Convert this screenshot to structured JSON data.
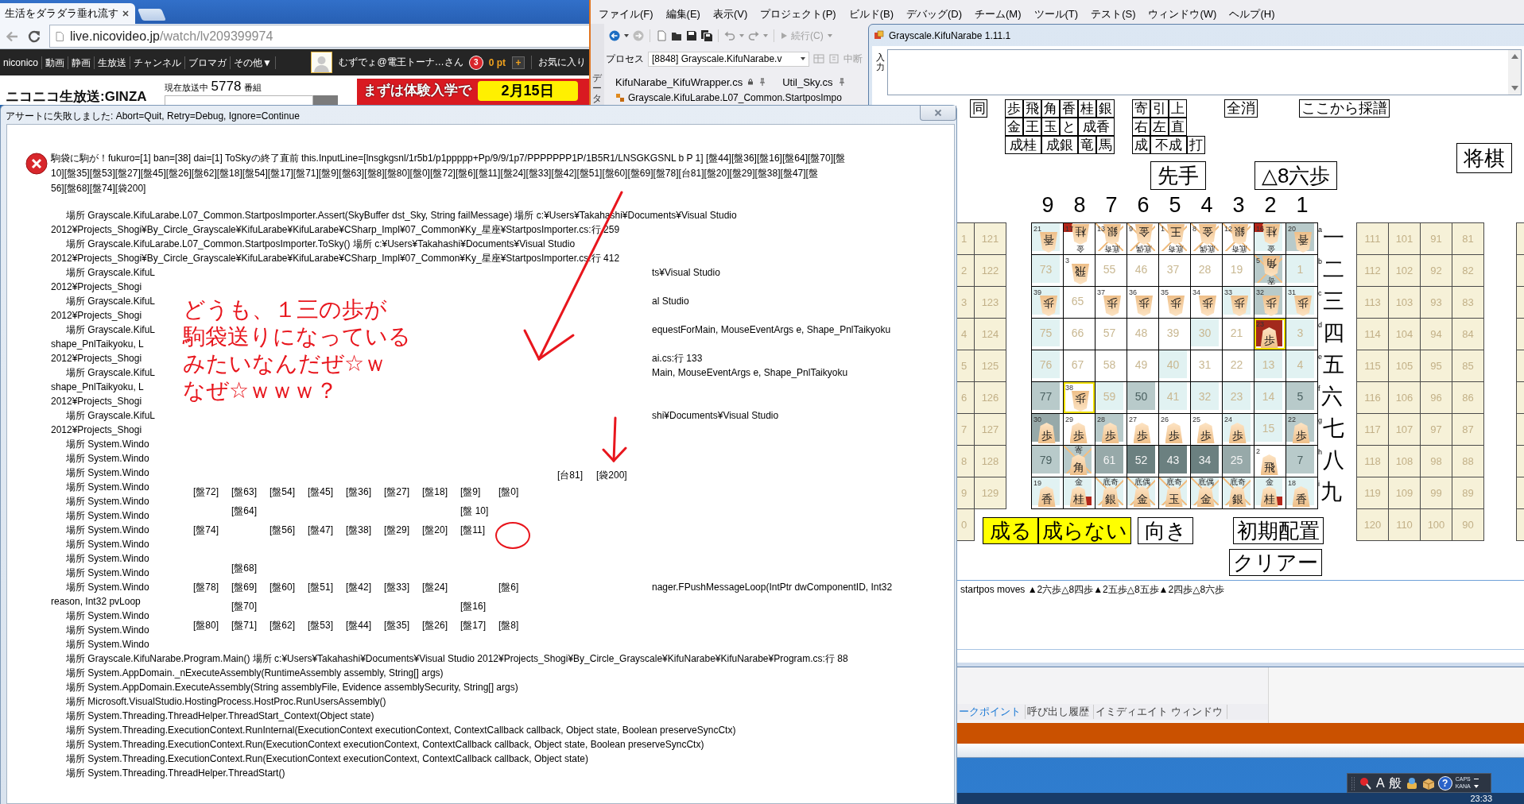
{
  "browser": {
    "tab_title": "生活をダラダラ垂れ流す",
    "url_host": "live.nicovideo.jp",
    "url_path": "/watch/lv209399974",
    "site_nav": [
      "niconico",
      "動画",
      "静画",
      "生放送",
      "チャンネル",
      "ブロマガ",
      "その他▼"
    ],
    "user_name": "むずでょ@電王トーナ…さん",
    "notice_count": "3",
    "points": "0 pt",
    "add_points": "+",
    "favorites": "お気に入り",
    "logo": "ニコニコ生放送:GINZA",
    "on_air_label": "現在放送中",
    "on_air_count": "5778",
    "on_air_unit": "番組",
    "banner_text": "まずは体験入学で",
    "banner_date": "2月15日"
  },
  "ide": {
    "menu": [
      "ファイル(F)",
      "編集(E)",
      "表示(V)",
      "プロジェクト(P)",
      "ビルド(B)",
      "デバッグ(D)",
      "チーム(M)",
      "ツール(T)",
      "テスト(S)",
      "ウィンドウ(W)",
      "ヘルプ(H)"
    ],
    "continue": "続行(C)",
    "process_label": "プロセス",
    "process": "[8848] Grayscale.KifuNarabe.v",
    "break_all": "中断",
    "doc_tabs": [
      "KifuNarabe_KifuWrapper.cs",
      "Util_Sky.cs"
    ],
    "navigation": "Grayscale.KifuLarabe.L07_Common.StartposImpo",
    "side_tab": "データ",
    "tool_tabs": [
      {
        "label": "ークポイント",
        "selected": true
      },
      {
        "label": "呼び出し履歴",
        "selected": false
      },
      {
        "label": "イミディエイト ウィンドウ",
        "selected": false
      }
    ]
  },
  "kifu_window": {
    "title": "Grayscale.KifuNarabe 1.11.1",
    "input_label": "入力",
    "same_button": "同",
    "piece_buttons": [
      [
        "歩",
        "飛",
        "角",
        "香",
        "桂",
        "銀"
      ],
      [
        "金",
        "王",
        "玉",
        "と",
        "成香"
      ],
      [
        "成桂",
        "成銀",
        "竜",
        "馬"
      ]
    ],
    "move_buttons": [
      [
        "寄",
        "引",
        "上"
      ],
      [
        "右",
        "左",
        "直"
      ],
      [
        "成",
        "不成",
        "打"
      ]
    ],
    "clear_all": "全消",
    "record_from_here": "ここから採譜",
    "engine": "将棋",
    "turn": "先手",
    "last_move": "△8六歩",
    "files": [
      "9",
      "8",
      "7",
      "6",
      "5",
      "4",
      "3",
      "2",
      "1"
    ],
    "ranks": [
      {
        "letter": "a",
        "numeral": "一"
      },
      {
        "letter": "b",
        "numeral": "二"
      },
      {
        "letter": "c",
        "numeral": "三"
      },
      {
        "letter": "d",
        "numeral": "四"
      },
      {
        "letter": "e",
        "numeral": "五"
      },
      {
        "letter": "f",
        "numeral": "六"
      },
      {
        "letter": "g",
        "numeral": "七"
      },
      {
        "letter": "h",
        "numeral": "八"
      },
      {
        "letter": "i",
        "numeral": "九"
      }
    ],
    "board": [
      [
        {
          "number": "21",
          "piece": "香",
          "flipped": true,
          "color": "#e1f2f2",
          "highlighted": false,
          "marked": false,
          "crossed": false
        },
        {
          "number": "17",
          "label": "金",
          "piece": "桂",
          "flipped": true,
          "color": "#ffffff",
          "highlighted": false,
          "marked": true,
          "crossed": false
        },
        {
          "number": "13",
          "label": "底奇",
          "piece": "銀",
          "flipped": true,
          "color": "#ffffff",
          "highlighted": false,
          "marked": false,
          "crossed": true
        },
        {
          "number": "9",
          "label": "底偶",
          "piece": "金",
          "flipped": true,
          "color": "#ffffff",
          "highlighted": false,
          "marked": false,
          "crossed": true
        },
        {
          "number": "1",
          "label": "底奇",
          "piece": "王",
          "flipped": true,
          "color": "#ffffff",
          "highlighted": false,
          "marked": false,
          "crossed": true
        },
        {
          "number": "8",
          "label": "底偶",
          "piece": "金",
          "flipped": true,
          "color": "#ffffff",
          "highlighted": false,
          "marked": false,
          "crossed": true
        },
        {
          "number": "12",
          "label": "底奇",
          "piece": "銀",
          "flipped": true,
          "color": "#ffffff",
          "highlighted": false,
          "marked": false,
          "crossed": true
        },
        {
          "number": "16",
          "label": "金",
          "piece": "桂",
          "flipped": true,
          "color": "#e1f2f2",
          "highlighted": false,
          "marked": true,
          "crossed": false
        },
        {
          "number": "20",
          "piece": "香",
          "flipped": true,
          "color": "#b8caca",
          "highlighted": false,
          "marked": false,
          "crossed": false
        }
      ],
      [
        {
          "number": "73",
          "color": "#e1f2f2",
          "highlighted": false,
          "marked": false,
          "crossed": false
        },
        {
          "number": "3",
          "piece": "飛",
          "flipped": true,
          "color": "#ffffff",
          "highlighted": false,
          "marked": false,
          "crossed": false
        },
        {
          "number": "55",
          "color": "#ffffff",
          "highlighted": false,
          "marked": false,
          "crossed": false
        },
        {
          "number": "46",
          "color": "#ffffff",
          "highlighted": false,
          "marked": false,
          "crossed": false
        },
        {
          "number": "37",
          "color": "#ffffff",
          "highlighted": false,
          "marked": false,
          "crossed": false
        },
        {
          "number": "28",
          "color": "#ffffff",
          "highlighted": false,
          "marked": false,
          "crossed": false
        },
        {
          "number": "19",
          "color": "#ffffff",
          "highlighted": false,
          "marked": false,
          "crossed": false
        },
        {
          "number": "5",
          "label": "寄",
          "piece": "角",
          "flipped": true,
          "color": "#b8caca",
          "highlighted": false,
          "marked": false,
          "crossed": true
        },
        {
          "number": "1",
          "color": "#e1f2f2",
          "highlighted": false,
          "marked": false,
          "crossed": false
        }
      ],
      [
        {
          "number": "39",
          "piece": "歩",
          "flipped": true,
          "color": "#e1f2f2",
          "highlighted": false,
          "marked": false,
          "crossed": false
        },
        {
          "number": "65",
          "color": "#ffffff",
          "highlighted": false,
          "marked": false,
          "crossed": false
        },
        {
          "number": "37",
          "piece": "歩",
          "flipped": true,
          "color": "#ffffff",
          "highlighted": false,
          "marked": false,
          "crossed": false
        },
        {
          "number": "36",
          "piece": "歩",
          "flipped": true,
          "color": "#ffffff",
          "highlighted": false,
          "marked": false,
          "crossed": false
        },
        {
          "number": "35",
          "piece": "歩",
          "flipped": true,
          "color": "#ffffff",
          "highlighted": false,
          "marked": false,
          "crossed": false
        },
        {
          "number": "34",
          "piece": "歩",
          "flipped": true,
          "color": "#ffffff",
          "highlighted": false,
          "marked": false,
          "crossed": false
        },
        {
          "number": "33",
          "piece": "歩",
          "flipped": true,
          "color": "#e1f2f2",
          "highlighted": false,
          "marked": false,
          "crossed": false
        },
        {
          "number": "32",
          "piece": "歩",
          "flipped": true,
          "color": "#b8caca",
          "highlighted": false,
          "marked": false,
          "crossed": false
        },
        {
          "number": "31",
          "piece": "歩",
          "flipped": true,
          "color": "#e1f2f2",
          "highlighted": false,
          "marked": false,
          "crossed": false
        }
      ],
      [
        {
          "number": "75",
          "color": "#e1f2f2",
          "highlighted": false,
          "marked": false,
          "crossed": false
        },
        {
          "number": "66",
          "color": "#ffffff",
          "highlighted": false,
          "marked": false,
          "crossed": false
        },
        {
          "number": "57",
          "color": "#ffffff",
          "highlighted": false,
          "marked": false,
          "crossed": false
        },
        {
          "number": "48",
          "color": "#ffffff",
          "highlighted": false,
          "marked": false,
          "crossed": false
        },
        {
          "number": "39",
          "color": "#ffffff",
          "highlighted": false,
          "marked": false,
          "crossed": false
        },
        {
          "number": "30",
          "color": "#e1f2f2",
          "highlighted": false,
          "marked": false,
          "crossed": false
        },
        {
          "number": "21",
          "color": "#ffffff",
          "highlighted": false,
          "marked": false,
          "crossed": false
        },
        {
          "number": "23",
          "piece": "歩",
          "flipped": false,
          "color": "#a3291c",
          "highlighted": true,
          "marked": false,
          "crossed": false
        },
        {
          "number": "3",
          "color": "#e1f2f2",
          "highlighted": false,
          "marked": false,
          "crossed": false
        }
      ],
      [
        {
          "number": "76",
          "color": "#e1f2f2",
          "highlighted": false,
          "marked": false,
          "crossed": false
        },
        {
          "number": "67",
          "color": "#ffffff",
          "highlighted": false,
          "marked": false,
          "crossed": false
        },
        {
          "number": "58",
          "color": "#ffffff",
          "highlighted": false,
          "marked": false,
          "crossed": false
        },
        {
          "number": "49",
          "color": "#ffffff",
          "highlighted": false,
          "marked": false,
          "crossed": false
        },
        {
          "number": "40",
          "color": "#e1f2f2",
          "highlighted": false,
          "marked": false,
          "crossed": false
        },
        {
          "number": "31",
          "color": "#ffffff",
          "highlighted": false,
          "marked": false,
          "crossed": false
        },
        {
          "number": "22",
          "color": "#ffffff",
          "highlighted": false,
          "marked": false,
          "crossed": false
        },
        {
          "number": "13",
          "color": "#e1f2f2",
          "highlighted": false,
          "marked": false,
          "crossed": false
        },
        {
          "number": "4",
          "color": "#e1f2f2",
          "highlighted": false,
          "marked": false,
          "crossed": false
        }
      ],
      [
        {
          "number": "77",
          "color": "#b8caca",
          "highlighted": false,
          "marked": false,
          "crossed": false
        },
        {
          "number": "38",
          "piece": "歩",
          "flipped": true,
          "color": "#ffffff",
          "highlighted": true,
          "marked": false,
          "crossed": false
        },
        {
          "number": "59",
          "color": "#e1f2f2",
          "highlighted": false,
          "marked": false,
          "crossed": false
        },
        {
          "number": "50",
          "color": "#b8caca",
          "highlighted": false,
          "marked": false,
          "crossed": false
        },
        {
          "number": "41",
          "color": "#e1f2f2",
          "highlighted": false,
          "marked": false,
          "crossed": false
        },
        {
          "number": "32",
          "color": "#e1f2f2",
          "highlighted": false,
          "marked": false,
          "crossed": false
        },
        {
          "number": "23",
          "color": "#e1f2f2",
          "highlighted": false,
          "marked": false,
          "crossed": false
        },
        {
          "number": "14",
          "color": "#e1f2f2",
          "highlighted": false,
          "marked": false,
          "crossed": false
        },
        {
          "number": "5",
          "color": "#b8caca",
          "highlighted": false,
          "marked": false,
          "crossed": false
        }
      ],
      [
        {
          "number": "30",
          "piece": "歩",
          "flipped": false,
          "color": "#97a9a9",
          "highlighted": false,
          "marked": false,
          "crossed": false
        },
        {
          "number": "29",
          "piece": "歩",
          "flipped": false,
          "color": "#ffffff",
          "highlighted": false,
          "marked": false,
          "crossed": false
        },
        {
          "number": "28",
          "piece": "歩",
          "flipped": false,
          "color": "#b8caca",
          "highlighted": false,
          "marked": false,
          "crossed": false
        },
        {
          "number": "27",
          "piece": "歩",
          "flipped": false,
          "color": "#ffffff",
          "highlighted": false,
          "marked": false,
          "crossed": false
        },
        {
          "number": "26",
          "piece": "歩",
          "flipped": false,
          "color": "#ffffff",
          "highlighted": false,
          "marked": false,
          "crossed": false
        },
        {
          "number": "25",
          "piece": "歩",
          "flipped": false,
          "color": "#ffffff",
          "highlighted": false,
          "marked": false,
          "crossed": false
        },
        {
          "number": "24",
          "piece": "歩",
          "flipped": false,
          "color": "#e1f2f2",
          "highlighted": false,
          "marked": false,
          "crossed": false
        },
        {
          "number": "15",
          "color": "#e1f2f2",
          "highlighted": false,
          "marked": false,
          "crossed": false
        },
        {
          "number": "22",
          "piece": "歩",
          "flipped": false,
          "color": "#b8caca",
          "highlighted": false,
          "marked": false,
          "crossed": false
        }
      ],
      [
        {
          "number": "79",
          "color": "#b8caca",
          "highlighted": false,
          "marked": false,
          "crossed": false
        },
        {
          "label": "寄",
          "piece": "角",
          "flipped": false,
          "color": "#b8caca",
          "highlighted": false,
          "marked": false,
          "crossed": true
        },
        {
          "number": "61",
          "color": "#97a9a9",
          "highlighted": false,
          "marked": false,
          "crossed": false
        },
        {
          "number": "52",
          "color": "#6b8080",
          "highlighted": false,
          "marked": false,
          "crossed": false
        },
        {
          "number": "43",
          "color": "#6b8080",
          "highlighted": false,
          "marked": false,
          "crossed": false
        },
        {
          "number": "34",
          "color": "#6b8080",
          "highlighted": false,
          "marked": false,
          "crossed": false
        },
        {
          "number": "25",
          "color": "#97a9a9",
          "highlighted": false,
          "marked": false,
          "crossed": false
        },
        {
          "number": "2",
          "piece": "飛",
          "flipped": false,
          "color": "#ffffff",
          "highlighted": false,
          "marked": false,
          "crossed": false
        },
        {
          "number": "7",
          "color": "#b8caca",
          "highlighted": false,
          "marked": false,
          "crossed": false
        }
      ],
      [
        {
          "number": "19",
          "piece": "香",
          "flipped": false,
          "color": "#e1f2f2",
          "highlighted": false,
          "marked": false,
          "crossed": false
        },
        {
          "label": "金",
          "piece": "桂",
          "flipped": false,
          "color": "#e1f2f2",
          "highlighted": false,
          "marked": true,
          "crossed": false
        },
        {
          "label": "底奇",
          "piece": "銀",
          "flipped": false,
          "color": "#e1f2f2",
          "highlighted": false,
          "marked": false,
          "crossed": true
        },
        {
          "label": "底偶",
          "piece": "金",
          "flipped": false,
          "color": "#e1f2f2",
          "highlighted": false,
          "marked": false,
          "crossed": true
        },
        {
          "label": "底奇",
          "piece": "玉",
          "flipped": false,
          "color": "#e1f2f2",
          "highlighted": false,
          "marked": false,
          "crossed": true
        },
        {
          "label": "底偶",
          "piece": "金",
          "flipped": false,
          "color": "#e1f2f2",
          "highlighted": false,
          "marked": false,
          "crossed": true
        },
        {
          "label": "底奇",
          "piece": "銀",
          "flipped": false,
          "color": "#e1f2f2",
          "highlighted": false,
          "marked": false,
          "crossed": true
        },
        {
          "label": "金",
          "piece": "桂",
          "flipped": false,
          "color": "#e1f2f2",
          "highlighted": false,
          "marked": true,
          "crossed": false
        },
        {
          "number": "18",
          "piece": "香",
          "flipped": false,
          "color": "#e1f2f2",
          "highlighted": false,
          "marked": false,
          "crossed": false
        }
      ]
    ],
    "left_stand": {
      "edge": [
        "1",
        "2",
        "3",
        "4",
        "5",
        "6",
        "7",
        "8",
        "9",
        "0"
      ],
      "column": [
        "121",
        "122",
        "123",
        "124",
        "125",
        "126",
        "127",
        "128",
        "129"
      ]
    },
    "right_stand": [
      [
        "111",
        "112",
        "113",
        "114",
        "115",
        "116",
        "117",
        "118",
        "119",
        "120"
      ],
      [
        "101",
        "102",
        "103",
        "104",
        "105",
        "106",
        "107",
        "108",
        "109",
        "110"
      ],
      [
        "91",
        "92",
        "93",
        "94",
        "95",
        "96",
        "97",
        "98",
        "99",
        "100"
      ],
      [
        "81",
        "82",
        "83",
        "84",
        "85",
        "86",
        "87",
        "88",
        "89",
        "90"
      ]
    ],
    "promote": "成る",
    "no_promote": "成らない",
    "flip": "向き",
    "initial": "初期配置",
    "clear": "クリアー",
    "record": "startpos moves ▲2六歩△8四歩▲2五歩△8五歩▲2四歩△8六歩"
  },
  "dialog": {
    "title": "アサートに失敗しました: Abort=Quit, Retry=Debug, Ignore=Continue",
    "message": [
      "駒袋に駒が！fukuro=[1] ban=[38] dai=[1] ToSkyの終了直前 this.InputLine=[lnsgkgsnl/1r5b1/p1ppppp+Pp/9/9/1p7/PPPPPPP1P/1B5R1/LNSGKGSNL b P 1] [盤44][盤36][盤16][盤64][盤70][盤",
      "10][盤35][盤53][盤27][盤45][盤26][盤62][盤18][盤54][盤17][盤71][盤9][盤63][盤8][盤80][盤0][盤72][盤6][盤11][盤24][盤33][盤42][盤51][盤60][盤69][盤78][台81][盤20][盤29][盤38][盤47][盤",
      "56][盤68][盤74][袋200]"
    ],
    "trace": [
      {
        "kind": "frame",
        "text": "場所 Grayscale.KifuLarabe.L07_Common.StartposImporter.Assert(SkyBuffer dst_Sky, String failMessage) 場所 c:¥Users¥Takahashi¥Documents¥Visual Studio"
      },
      {
        "kind": "wrap",
        "text": "2012¥Projects_Shogi¥By_Circle_Grayscale¥KifuLarabe¥KifuLarabe¥CSharp_Impl¥07_Common¥Ky_星座¥StartposImporter.cs:行 259"
      },
      {
        "kind": "frame",
        "text": "場所 Grayscale.KifuLarabe.L07_Common.StartposImporter.ToSky() 場所 c:¥Users¥Takahashi¥Documents¥Visual Studio"
      },
      {
        "kind": "wrap",
        "text": "2012¥Projects_Shogi¥By_Circle_Grayscale¥KifuLarabe¥KifuLarabe¥CSharp_Impl¥07_Common¥Ky_星座¥StartposImporter.cs:行 412"
      },
      {
        "kind": "frame",
        "text": "場所 Grayscale.KifuL",
        "right": "ts¥Visual Studio"
      },
      {
        "kind": "wrap",
        "text": "2012¥Projects_Shogi"
      },
      {
        "kind": "frame",
        "text": "場所 Grayscale.KifuL",
        "right": "al Studio"
      },
      {
        "kind": "wrap",
        "text": "2012¥Projects_Shogi"
      },
      {
        "kind": "frame",
        "text": "場所 Grayscale.KifuL",
        "right": "equestForMain, MouseEventArgs e, Shape_PnlTaikyoku"
      },
      {
        "kind": "wrap",
        "text": "shape_PnlTaikyoku, L"
      },
      {
        "kind": "wrap",
        "text": "2012¥Projects_Shogi",
        "right": "ai.cs:行 133"
      },
      {
        "kind": "frame",
        "text": "場所 Grayscale.KifuL",
        "right": "Main, MouseEventArgs e, Shape_PnlTaikyoku"
      },
      {
        "kind": "wrap",
        "text": "shape_PnlTaikyoku, L"
      },
      {
        "kind": "wrap",
        "text": "2012¥Projects_Shogi"
      },
      {
        "kind": "frame",
        "text": "場所 Grayscale.KifuL",
        "right": "shi¥Documents¥Visual Studio"
      },
      {
        "kind": "wrap",
        "text": "2012¥Projects_Shogi"
      },
      {
        "kind": "frame",
        "text": "場所 System.Windo"
      },
      {
        "kind": "frame",
        "text": "場所 System.Windo"
      },
      {
        "kind": "frame",
        "text": "場所 System.Windo"
      },
      {
        "kind": "frame",
        "text": "場所 System.Windo"
      },
      {
        "kind": "frame",
        "text": "場所 System.Windo"
      },
      {
        "kind": "frame",
        "text": "場所 System.Windo"
      },
      {
        "kind": "frame",
        "text": "場所 System.Windo"
      },
      {
        "kind": "frame",
        "text": "場所 System.Windo"
      },
      {
        "kind": "frame",
        "text": "場所 System.Windo"
      },
      {
        "kind": "frame",
        "text": "場所 System.Windo"
      },
      {
        "kind": "frame",
        "text": "場所 System.Windo",
        "right": "nager.FPushMessageLoop(IntPtr dwComponentID, Int32"
      },
      {
        "kind": "wrap",
        "text": "reason, Int32 pvLoop"
      },
      {
        "kind": "frame",
        "text": "場所 System.Windo"
      },
      {
        "kind": "frame",
        "text": "場所 System.Windo"
      },
      {
        "kind": "frame",
        "text": "場所 System.Windo"
      },
      {
        "kind": "frame",
        "text": "場所 Grayscale.KifuNarabe.Program.Main() 場所 c:¥Users¥Takahashi¥Documents¥Visual Studio 2012¥Projects_Shogi¥By_Circle_Grayscale¥KifuNarabe¥KifuNarabe¥Program.cs:行 88"
      },
      {
        "kind": "frame",
        "text": "場所 System.AppDomain._nExecuteAssembly(RuntimeAssembly assembly, String[] args)"
      },
      {
        "kind": "frame",
        "text": "場所 System.AppDomain.ExecuteAssembly(String assemblyFile, Evidence assemblySecurity, String[] args)"
      },
      {
        "kind": "frame",
        "text": "場所 Microsoft.VisualStudio.HostingProcess.HostProc.RunUsersAssembly()"
      },
      {
        "kind": "frame",
        "text": "場所 System.Threading.ThreadHelper.ThreadStart_Context(Object state)"
      },
      {
        "kind": "frame",
        "text": "場所 System.Threading.ExecutionContext.RunInternal(ExecutionContext executionContext, ContextCallback callback, Object state, Boolean preserveSyncCtx)"
      },
      {
        "kind": "frame",
        "text": "場所 System.Threading.ExecutionContext.Run(ExecutionContext executionContext, ContextCallback callback, Object state, Boolean preserveSyncCtx)"
      },
      {
        "kind": "frame",
        "text": "場所 System.Threading.ExecutionContext.Run(ExecutionContext executionContext, ContextCallback callback, Object state)"
      },
      {
        "kind": "frame",
        "text": "場所 System.Threading.ThreadHelper.ThreadStart()"
      }
    ],
    "note": {
      "lines": [
        "どうも、１三の歩が",
        "駒袋送りになっている",
        "みたいなんだぜ☆ｗ",
        "なぜ☆ｗｗｗ？"
      ],
      "top_labels": [
        "[台81]",
        "[袋200]"
      ],
      "grid": [
        [
          {
            "kind": "label",
            "text": "[盤72]"
          },
          {
            "kind": "label",
            "text": "[盤63]"
          },
          {
            "kind": "label",
            "text": "[盤54]"
          },
          {
            "kind": "label",
            "text": "[盤45]"
          },
          {
            "kind": "label",
            "text": "[盤36]"
          },
          {
            "kind": "label",
            "text": "[盤27]"
          },
          {
            "kind": "label",
            "text": "[盤18]"
          },
          {
            "kind": "label",
            "text": "[盤9]"
          },
          {
            "kind": "label",
            "text": "[盤0]"
          }
        ],
        [
          {
            "kind": "gap"
          },
          {
            "kind": "label",
            "text": "[盤64]"
          },
          {
            "kind": "gap"
          },
          {
            "kind": "gap"
          },
          {
            "kind": "gap"
          },
          {
            "kind": "gap"
          },
          {
            "kind": "gap"
          },
          {
            "kind": "label",
            "text": "[盤 10]"
          },
          {
            "kind": "gap"
          }
        ],
        [
          {
            "kind": "label",
            "text": "[盤74]"
          },
          {
            "kind": "gap"
          },
          {
            "kind": "label",
            "text": "[盤56]"
          },
          {
            "kind": "label",
            "text": "[盤47]"
          },
          {
            "kind": "label",
            "text": "[盤38]"
          },
          {
            "kind": "label",
            "text": "[盤29]"
          },
          {
            "kind": "label",
            "text": "[盤20]"
          },
          {
            "kind": "label",
            "text": "[盤11]"
          },
          {
            "kind": "circle"
          }
        ],
        [
          {
            "kind": "gap"
          },
          {
            "kind": "gap"
          },
          {
            "kind": "gap"
          },
          {
            "kind": "gap"
          },
          {
            "kind": "gap"
          },
          {
            "kind": "gap"
          },
          {
            "kind": "gap"
          },
          {
            "kind": "gap"
          },
          {
            "kind": "gap"
          }
        ],
        [
          {
            "kind": "gap"
          },
          {
            "kind": "label",
            "text": "[盤68]"
          },
          {
            "kind": "gap"
          },
          {
            "kind": "gap"
          },
          {
            "kind": "gap"
          },
          {
            "kind": "gap"
          },
          {
            "kind": "gap"
          },
          {
            "kind": "gap"
          },
          {
            "kind": "gap"
          }
        ],
        [
          {
            "kind": "label",
            "text": "[盤78]"
          },
          {
            "kind": "label",
            "text": "[盤69]"
          },
          {
            "kind": "label",
            "text": "[盤60]"
          },
          {
            "kind": "label",
            "text": "[盤51]"
          },
          {
            "kind": "label",
            "text": "[盤42]"
          },
          {
            "kind": "label",
            "text": "[盤33]"
          },
          {
            "kind": "label",
            "text": "[盤24]"
          },
          {
            "kind": "gap"
          },
          {
            "kind": "label",
            "text": "[盤6]"
          }
        ],
        [
          {
            "kind": "gap"
          },
          {
            "kind": "label",
            "text": "[盤70]"
          },
          {
            "kind": "gap"
          },
          {
            "kind": "gap"
          },
          {
            "kind": "gap"
          },
          {
            "kind": "gap"
          },
          {
            "kind": "gap"
          },
          {
            "kind": "label",
            "text": "[盤16]"
          },
          {
            "kind": "gap"
          }
        ],
        [
          {
            "kind": "label",
            "text": "[盤80]"
          },
          {
            "kind": "label",
            "text": "[盤71]"
          },
          {
            "kind": "label",
            "text": "[盤62]"
          },
          {
            "kind": "label",
            "text": "[盤53]"
          },
          {
            "kind": "label",
            "text": "[盤44]"
          },
          {
            "kind": "label",
            "text": "[盤35]"
          },
          {
            "kind": "label",
            "text": "[盤26]"
          },
          {
            "kind": "label",
            "text": "[盤17]"
          },
          {
            "kind": "label",
            "text": "[盤8]"
          }
        ]
      ]
    }
  },
  "taskbar": {
    "input_mode": "A",
    "conversion_mode": "般",
    "help": "?",
    "caps": "CAPS",
    "kana": "KANA",
    "clock": "23:33"
  }
}
